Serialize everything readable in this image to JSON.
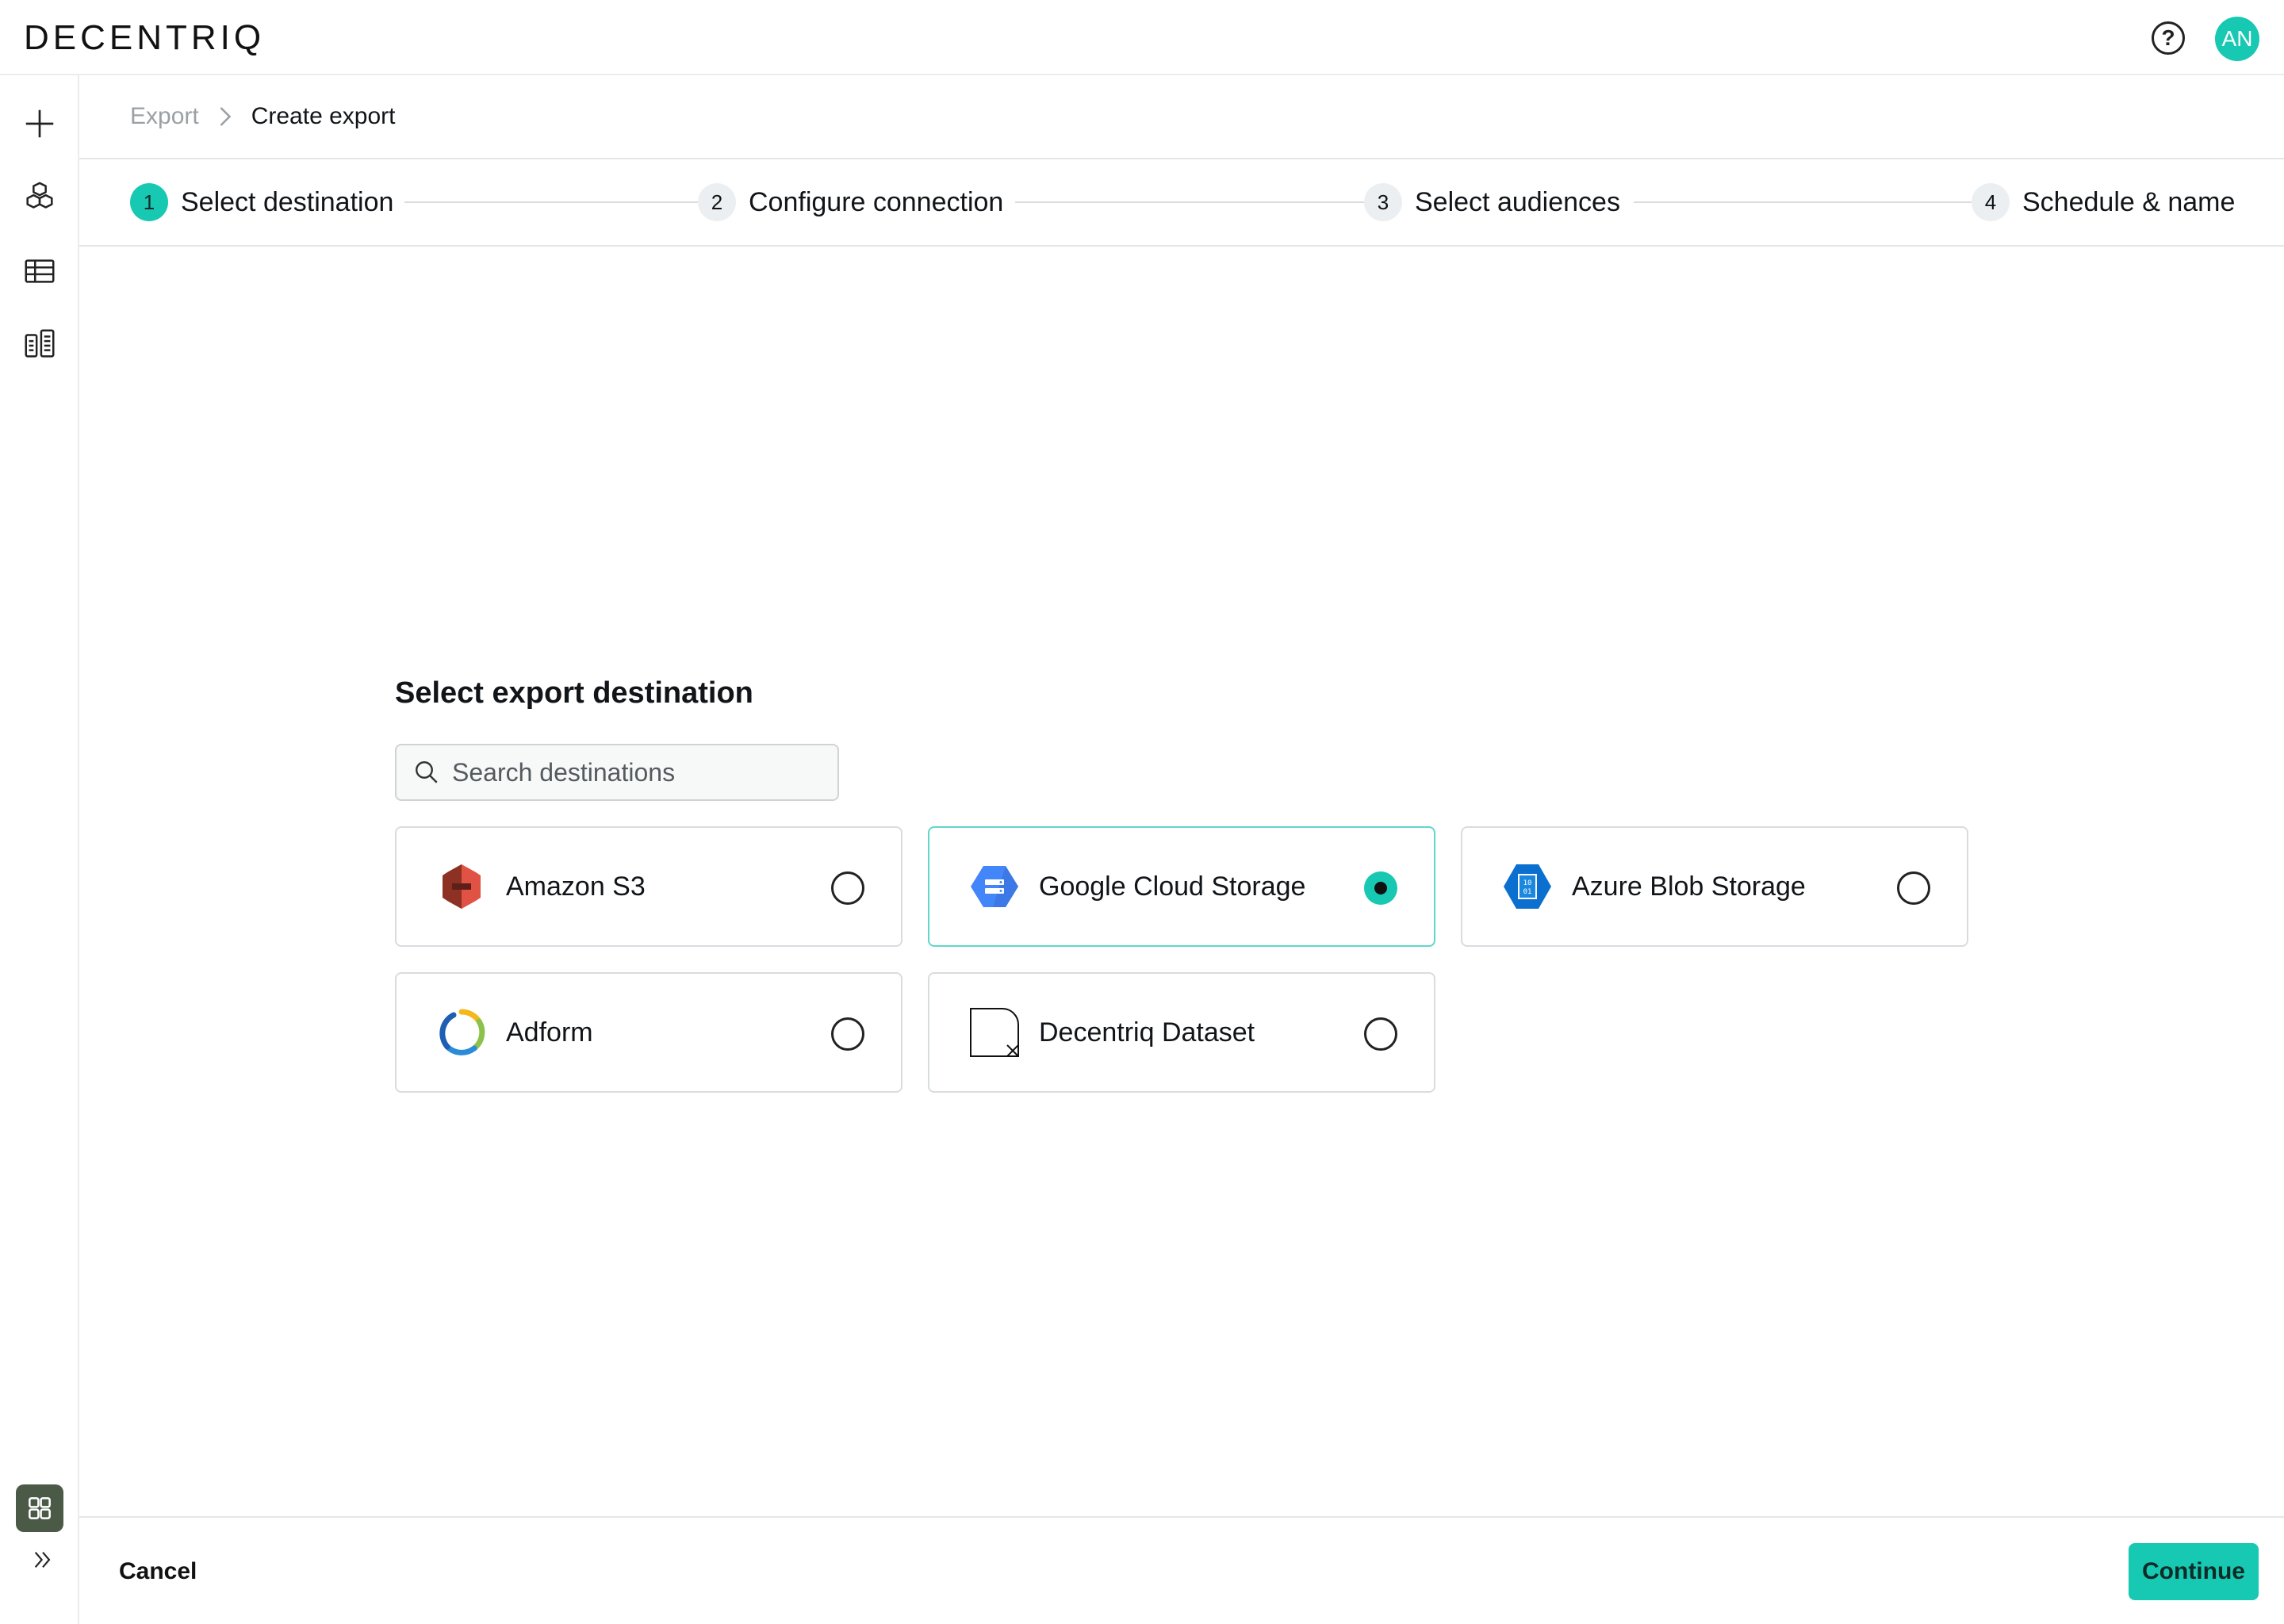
{
  "app": {
    "logo_text": "DECENTRIQ",
    "help_symbol": "?",
    "avatar_initials": "AN"
  },
  "colors": {
    "accent": "#17c8b2",
    "border": "#d9dcdf",
    "text": "#111418",
    "muted": "#9aa0a6",
    "rail_home_bg": "#4b5a47"
  },
  "rail": {
    "items": [
      {
        "name": "plus-icon"
      },
      {
        "name": "cubes-icon"
      },
      {
        "name": "table-icon"
      },
      {
        "name": "grid-list-icon"
      }
    ],
    "bottom": [
      {
        "name": "home-grid-icon"
      },
      {
        "name": "chevrons-right-icon"
      }
    ]
  },
  "breadcrumb": {
    "parent": "Export",
    "current": "Create export",
    "separator_icon": "chevron-right-icon"
  },
  "stepper": {
    "steps": [
      {
        "number": "1",
        "label": "Select destination",
        "active": true
      },
      {
        "number": "2",
        "label": "Configure connection",
        "active": false
      },
      {
        "number": "3",
        "label": "Select audiences",
        "active": false
      },
      {
        "number": "4",
        "label": "Schedule & name",
        "active": false
      }
    ]
  },
  "main": {
    "title": "Select export destination",
    "search": {
      "placeholder": "Search destinations",
      "value": "",
      "icon": "search-icon"
    },
    "destinations": [
      {
        "label": "Amazon S3",
        "icon": "amazon-s3-icon",
        "selected": false
      },
      {
        "label": "Google Cloud Storage",
        "icon": "google-cloud-storage-icon",
        "selected": true
      },
      {
        "label": "Azure Blob Storage",
        "icon": "azure-blob-storage-icon",
        "selected": false
      },
      {
        "label": "Adform",
        "icon": "adform-icon",
        "selected": false
      },
      {
        "label": "Decentriq Dataset",
        "icon": "decentriq-dataset-icon",
        "selected": false
      }
    ]
  },
  "footer": {
    "cancel_label": "Cancel",
    "continue_label": "Continue"
  }
}
